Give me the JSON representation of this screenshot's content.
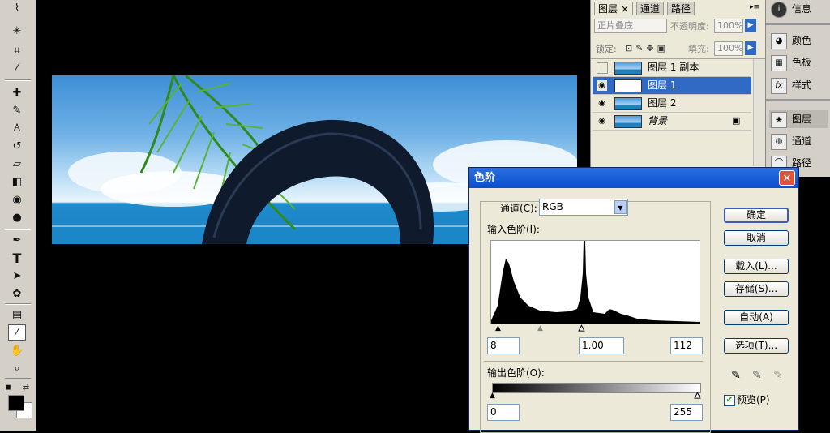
{
  "toolbox": {
    "tools": [
      "lasso-tool",
      "magic-wand-tool",
      "crop-tool",
      "slice-tool",
      "healing-brush-tool",
      "brush-tool",
      "clone-stamp-tool",
      "history-brush-tool",
      "eraser-tool",
      "gradient-tool",
      "blur-tool",
      "dodge-tool",
      "pen-tool",
      "type-tool",
      "path-selection-tool",
      "custom-shape-tool",
      "notes-tool",
      "eyedropper-tool",
      "hand-tool",
      "zoom-tool"
    ],
    "type_glyph": "T"
  },
  "layers_panel": {
    "tabs": [
      "图层 ×",
      "通道",
      "路径"
    ],
    "blend_mode": "正片叠底",
    "opacity_label": "不透明度:",
    "opacity_value": "100%",
    "lock_label": "锁定:",
    "fill_label": "填充:",
    "fill_value": "100%",
    "layers": [
      {
        "name": "图层 1 副本",
        "visible": false,
        "selected": false
      },
      {
        "name": "图层 1",
        "visible": true,
        "selected": true
      },
      {
        "name": "图层 2",
        "visible": true,
        "selected": false
      },
      {
        "name": "背景",
        "visible": true,
        "selected": false,
        "locked": true
      }
    ]
  },
  "dock": {
    "items": [
      "信息",
      "颜色",
      "色板",
      "样式",
      "图层",
      "通道",
      "路径"
    ]
  },
  "levels_dialog": {
    "title": "色阶",
    "channel_label": "通道(C):",
    "channel_value": "RGB",
    "input_label": "输入色阶(I):",
    "input_black": "8",
    "input_gamma": "1.00",
    "input_white": "112",
    "output_label": "输出色阶(O):",
    "output_black": "0",
    "output_white": "255",
    "buttons": {
      "ok": "确定",
      "cancel": "取消",
      "load": "载入(L)...",
      "save": "存储(S)...",
      "auto": "自动(A)",
      "options": "选项(T)..."
    },
    "preview_label": "预览(P)",
    "preview_checked": true
  }
}
